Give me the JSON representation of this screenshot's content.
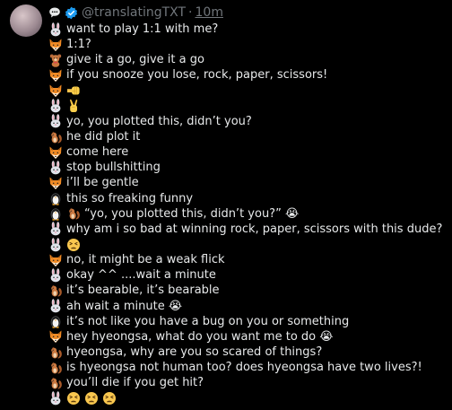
{
  "post": {
    "handle": "@translatingTXT",
    "separator": "·",
    "time": "10m"
  },
  "lines": [
    {
      "icons": [
        "rabbit"
      ],
      "text": "want to play 1:1 with me?"
    },
    {
      "icons": [
        "fox"
      ],
      "text": "1:1?"
    },
    {
      "icons": [
        "bear"
      ],
      "text": "give it a go, give it a go"
    },
    {
      "icons": [
        "fox"
      ],
      "text": "if you snooze you lose, rock, paper, scissors!"
    },
    {
      "icons": [
        "fox",
        "fist"
      ],
      "text": ""
    },
    {
      "icons": [
        "rabbit",
        "victory"
      ],
      "text": ""
    },
    {
      "icons": [
        "rabbit"
      ],
      "text": "yo, you plotted this, didn’t you?"
    },
    {
      "icons": [
        "squirrel"
      ],
      "text": "he did plot it"
    },
    {
      "icons": [
        "fox"
      ],
      "text": "come here"
    },
    {
      "icons": [
        "rabbit"
      ],
      "text": "stop bullshitting"
    },
    {
      "icons": [
        "fox"
      ],
      "text": "i’ll be gentle"
    },
    {
      "icons": [
        "penguin"
      ],
      "text": "this so freaking funny"
    },
    {
      "icons": [
        "penguin",
        "squirrel"
      ],
      "text": "“yo, you plotted this, didn’t you?” 😭"
    },
    {
      "icons": [
        "rabbit"
      ],
      "text": "why am i so bad at winning rock, paper, scissors with this dude?"
    },
    {
      "icons": [
        "rabbit",
        "tired"
      ],
      "text": ""
    },
    {
      "icons": [
        "fox"
      ],
      "text": "no, it might be a weak flick"
    },
    {
      "icons": [
        "rabbit"
      ],
      "text": "okay ^^ ....wait a minute"
    },
    {
      "icons": [
        "squirrel"
      ],
      "text": "it’s bearable, it’s bearable"
    },
    {
      "icons": [
        "rabbit"
      ],
      "text": "ah wait a minute 😭"
    },
    {
      "icons": [
        "penguin"
      ],
      "text": "it’s not like you have a bug on you or something"
    },
    {
      "icons": [
        "fox"
      ],
      "text": "hey hyeongsa, what do you want me to do 😭"
    },
    {
      "icons": [
        "squirrel"
      ],
      "text": "hyeongsa, why are you so scared of things?"
    },
    {
      "icons": [
        "squirrel"
      ],
      "text": "is hyeongsa not human too? does hyeongsa have two lives?!"
    },
    {
      "icons": [
        "squirrel"
      ],
      "text": "you’ll die if you get hit?"
    },
    {
      "icons": [
        "rabbit",
        "tired",
        "tired",
        "tired"
      ],
      "text": ""
    }
  ],
  "icon_names": {
    "rabbit": "rabbit-face-icon",
    "fox": "fox-face-icon",
    "bear": "teddy-bear-icon",
    "squirrel": "chipmunk-icon",
    "penguin": "penguin-icon",
    "fist": "right-facing-fist-icon",
    "victory": "victory-hand-icon",
    "tired": "tired-face-icon"
  },
  "colors": {
    "background": "#000000",
    "text": "#e7e9ea",
    "muted": "#71767b",
    "verified": "#1d9bf0"
  }
}
